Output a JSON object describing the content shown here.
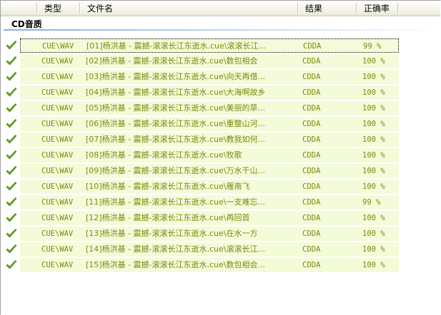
{
  "columns": {
    "type": "类型",
    "filename": "文件名",
    "result": "结果",
    "accuracy": "正确率"
  },
  "group": {
    "title": "CD音质"
  },
  "colors": {
    "row_bg": "#f3fbd9",
    "text": "#7a8a0e",
    "check": "#6aa31c"
  },
  "rows": [
    {
      "type": "CUE\\WAV",
      "filename": "[01]杨洪基 - 震撼-滚滚长江东逝水.cue\\滚滚长江...",
      "result": "CDDA",
      "accuracy": "99 %"
    },
    {
      "type": "CUE\\WAV",
      "filename": "[02]杨洪基 - 震撼-滚滚长江东逝水.cue\\数包相会",
      "result": "CDDA",
      "accuracy": "100 %"
    },
    {
      "type": "CUE\\WAV",
      "filename": "[03]杨洪基 - 震撼-滚滚长江东逝水.cue\\向天再借...",
      "result": "CDDA",
      "accuracy": "100 %"
    },
    {
      "type": "CUE\\WAV",
      "filename": "[04]杨洪基 - 震撼-滚滚长江东逝水.cue\\大海啊故乡",
      "result": "CDDA",
      "accuracy": "100 %"
    },
    {
      "type": "CUE\\WAV",
      "filename": "[05]杨洪基 - 震撼-滚滚长江东逝水.cue\\美丽的草...",
      "result": "CDDA",
      "accuracy": "100 %"
    },
    {
      "type": "CUE\\WAV",
      "filename": "[06]杨洪基 - 震撼-滚滚长江东逝水.cue\\重整山河...",
      "result": "CDDA",
      "accuracy": "100 %"
    },
    {
      "type": "CUE\\WAV",
      "filename": "[07]杨洪基 - 震撼-滚滚长江东逝水.cue\\教我如何...",
      "result": "CDDA",
      "accuracy": "100 %"
    },
    {
      "type": "CUE\\WAV",
      "filename": "[08]杨洪基 - 震撼-滚滚长江东逝水.cue\\牧歌",
      "result": "CDDA",
      "accuracy": "100 %"
    },
    {
      "type": "CUE\\WAV",
      "filename": "[09]杨洪基 - 震撼-滚滚长江东逝水.cue\\万水千山...",
      "result": "CDDA",
      "accuracy": "100 %"
    },
    {
      "type": "CUE\\WAV",
      "filename": "[10]杨洪基 - 震撼-滚滚长江东逝水.cue\\雁南飞",
      "result": "CDDA",
      "accuracy": "100 %"
    },
    {
      "type": "CUE\\WAV",
      "filename": "[11]杨洪基 - 震撼-滚滚长江东逝水.cue\\一支难忘...",
      "result": "CDDA",
      "accuracy": "99 %"
    },
    {
      "type": "CUE\\WAV",
      "filename": "[12]杨洪基 - 震撼-滚滚长江东逝水.cue\\再回首",
      "result": "CDDA",
      "accuracy": "100 %"
    },
    {
      "type": "CUE\\WAV",
      "filename": "[13]杨洪基 - 震撼-滚滚长江东逝水.cue\\在水一方",
      "result": "CDDA",
      "accuracy": "100 %"
    },
    {
      "type": "CUE\\WAV",
      "filename": "[14]杨洪基 - 震撼-滚滚长江东逝水.cue\\滚滚长江...",
      "result": "CDDA",
      "accuracy": "100 %"
    },
    {
      "type": "CUE\\WAV",
      "filename": "[15]杨洪基 - 震撼-滚滚长江东逝水.cue\\数包相会...",
      "result": "CDDA",
      "accuracy": "100 %"
    }
  ],
  "icons": {
    "row_status": "checkmark-icon"
  }
}
